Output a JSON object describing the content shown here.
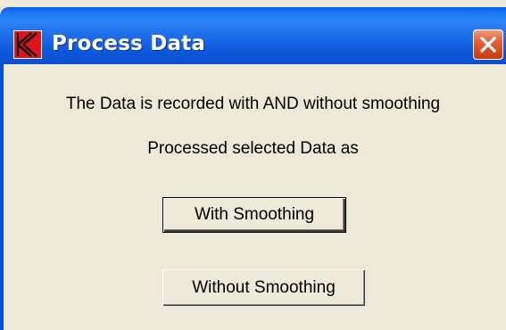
{
  "window": {
    "title": "Process Data",
    "app_icon": "k-logo-icon",
    "close_icon": "close-icon",
    "colors": {
      "titlebar": "#0a5fe6",
      "close_button": "#e25a2f",
      "face": "#ece9d8",
      "logo_red": "#e0141e"
    }
  },
  "dialog": {
    "message_line1": "The Data is recorded with AND without smoothing",
    "message_line2": "Processed selected Data as",
    "with_smoothing_label": "With Smoothing",
    "without_smoothing_label": "Without Smoothing"
  }
}
